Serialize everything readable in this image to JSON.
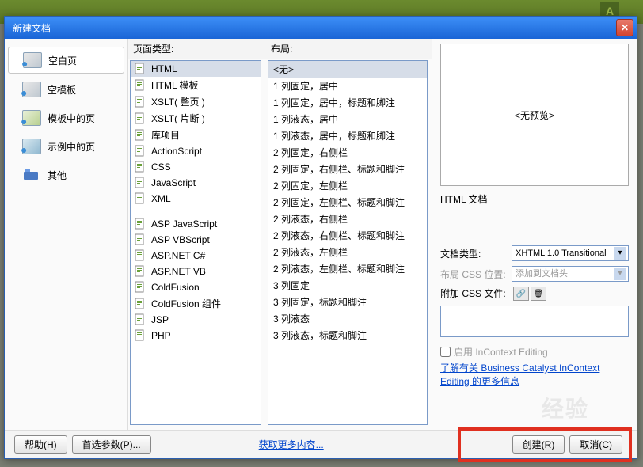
{
  "backdrop_logo": "A",
  "dialog": {
    "title": "新建文档"
  },
  "categories": [
    {
      "id": "blank",
      "label": "空白页",
      "selected": true
    },
    {
      "id": "template",
      "label": "空模板"
    },
    {
      "id": "tpl-page",
      "label": "模板中的页"
    },
    {
      "id": "sample-page",
      "label": "示例中的页"
    },
    {
      "id": "other",
      "label": "其他"
    }
  ],
  "page_type_header": "页面类型:",
  "page_types_a": [
    {
      "label": "HTML",
      "selected": true
    },
    {
      "label": "HTML 模板"
    },
    {
      "label": "XSLT( 整页 )"
    },
    {
      "label": "XSLT( 片断 )"
    },
    {
      "label": "库项目"
    },
    {
      "label": "ActionScript"
    },
    {
      "label": "CSS"
    },
    {
      "label": "JavaScript"
    },
    {
      "label": "XML"
    }
  ],
  "page_types_b": [
    {
      "label": "ASP JavaScript"
    },
    {
      "label": "ASP VBScript"
    },
    {
      "label": "ASP.NET C#"
    },
    {
      "label": "ASP.NET VB"
    },
    {
      "label": "ColdFusion"
    },
    {
      "label": "ColdFusion 组件"
    },
    {
      "label": "JSP"
    },
    {
      "label": "PHP"
    }
  ],
  "layout_header": "布局:",
  "layouts": [
    {
      "label": "<无>",
      "selected": true
    },
    {
      "label": "1 列固定，居中"
    },
    {
      "label": "1 列固定，居中，标题和脚注"
    },
    {
      "label": "1 列液态，居中"
    },
    {
      "label": "1 列液态，居中，标题和脚注"
    },
    {
      "label": "2 列固定，右侧栏"
    },
    {
      "label": "2 列固定，右侧栏、标题和脚注"
    },
    {
      "label": "2 列固定，左侧栏"
    },
    {
      "label": "2 列固定，左侧栏、标题和脚注"
    },
    {
      "label": "2 列液态，右侧栏"
    },
    {
      "label": "2 列液态，右侧栏、标题和脚注"
    },
    {
      "label": "2 列液态，左侧栏"
    },
    {
      "label": "2 列液态，左侧栏、标题和脚注"
    },
    {
      "label": "3 列固定"
    },
    {
      "label": "3 列固定，标题和脚注"
    },
    {
      "label": "3 列液态"
    },
    {
      "label": "3 列液态，标题和脚注"
    }
  ],
  "preview_text": "<无预览>",
  "description": "HTML 文档",
  "doctype_label": "文档类型:",
  "doctype_value": "XHTML 1.0 Transitional",
  "layout_css_label": "布局 CSS 位置:",
  "layout_css_value": "添加到文档头",
  "attach_css_label": "附加 CSS 文件:",
  "enable_incontext": "启用 InContext Editing",
  "learn_link": "了解有关 Business Catalyst InContext Editing 的更多信息",
  "footer": {
    "help": "帮助(H)",
    "prefs": "首选参数(P)...",
    "more": "获取更多内容...",
    "create": "创建(R)",
    "cancel": "取消(C)"
  }
}
